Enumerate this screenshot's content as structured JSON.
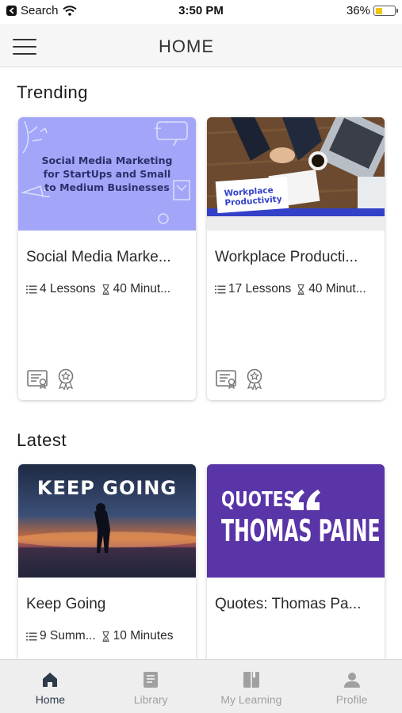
{
  "status_bar": {
    "back_label": "Search",
    "time": "3:50 PM",
    "battery": "36%",
    "battery_level": 0.36
  },
  "header": {
    "title": "HOME"
  },
  "sections": {
    "trending": {
      "title": "Trending",
      "cards": [
        {
          "thumb_text": "Social Media Marketing\nfor StartUps and Small\nto Medium Businesses",
          "title": "Social Media Marke...",
          "lessons": "4 Lessons",
          "duration": "40 Minut..."
        },
        {
          "thumb_text": "Workplace\nProductivity",
          "title": "Workplace Producti...",
          "lessons": "17 Lessons",
          "duration": "40 Minut..."
        }
      ]
    },
    "latest": {
      "title": "Latest",
      "cards": [
        {
          "thumb_text": "KEEP GOING",
          "title": "Keep Going",
          "lessons": "9 Summ...",
          "duration": "10 Minutes"
        },
        {
          "thumb_text_top": "QUOTES",
          "thumb_text_main": "THOMAS PAINE",
          "title": "Quotes: Thomas Pa..."
        }
      ]
    }
  },
  "bottom_nav": [
    {
      "label": "Home",
      "icon": "home-icon",
      "active": true
    },
    {
      "label": "Library",
      "icon": "library-icon",
      "active": false
    },
    {
      "label": "My Learning",
      "icon": "book-icon",
      "active": false
    },
    {
      "label": "Profile",
      "icon": "person-icon",
      "active": false
    }
  ],
  "colors": {
    "accent": "#2e3a4c",
    "inactive": "#a0a0a0",
    "card_purple": "#a3a6f8",
    "quotes_purple": "#5a35a8"
  }
}
